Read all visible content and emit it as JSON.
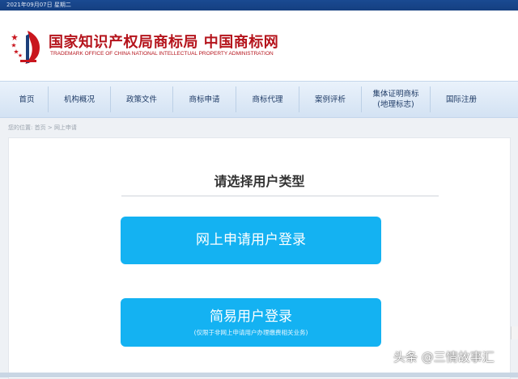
{
  "topbar": {
    "date": "2021年09月07日 星期二"
  },
  "header": {
    "title_cn": "国家知识产权局商标局 中国商标网",
    "title_en": "TRADEMARK OFFICE OF CHINA NATIONAL INTELLECTUAL PROPERTY ADMINISTRATION"
  },
  "nav": {
    "items": [
      {
        "label": "首页"
      },
      {
        "label": "机构概况"
      },
      {
        "label": "政策文件"
      },
      {
        "label": "商标申请"
      },
      {
        "label": "商标代理"
      },
      {
        "label": "案例评析"
      },
      {
        "label": "集体证明商标\n(地理标志)"
      },
      {
        "label": "国际注册"
      }
    ]
  },
  "breadcrumb": {
    "prefix": "您的位置:",
    "home": "首页",
    "sep": ">",
    "current": "网上申请"
  },
  "main": {
    "title": "请选择用户类型",
    "online_login": "网上申请用户登录",
    "simple_login": "简易用户登录",
    "simple_login_note": "(仅限于非网上申请用户办理缴费相关业务)"
  },
  "watermark": "头条 @三情故事汇",
  "colors": {
    "accent": "#14b2f2",
    "brand_red": "#b5141c",
    "topbar": "#1a4a92"
  }
}
